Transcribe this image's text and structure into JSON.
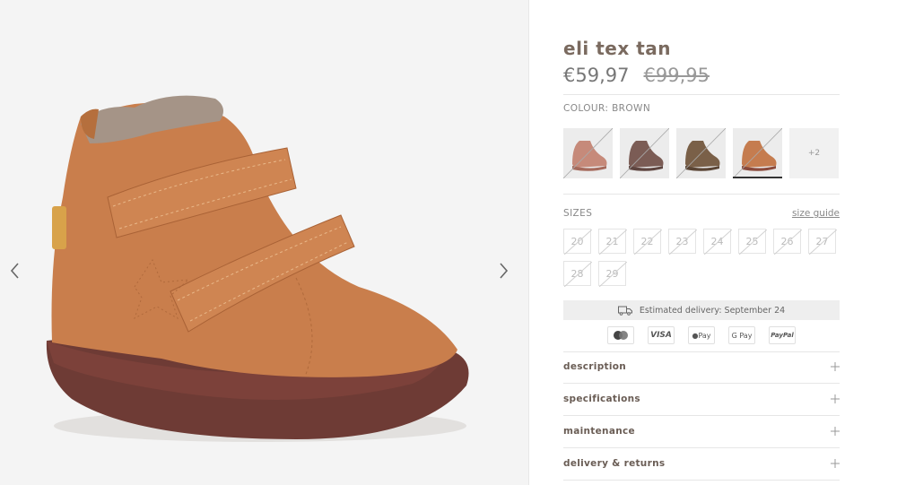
{
  "product": {
    "title": "eli tex tan",
    "price_current": "€59,97",
    "price_original": "€99,95",
    "colour_label": "COLOUR: BROWN"
  },
  "gallery": {
    "prev_icon": "chevron-left-icon",
    "next_icon": "chevron-right-icon"
  },
  "colours": {
    "swatches": [
      {
        "name": "pink",
        "color": "#c68a7a",
        "sole": "#a56a5c"
      },
      {
        "name": "mauve-brown",
        "color": "#7b5c55",
        "sole": "#5e4540"
      },
      {
        "name": "dark-brown",
        "color": "#7a6048",
        "sole": "#5a4535"
      },
      {
        "name": "tan",
        "color": "#c57c4f",
        "sole": "#8a4a3c"
      }
    ],
    "more_label": "+2"
  },
  "sizes": {
    "label": "SIZES",
    "guide_label": "size guide",
    "options": [
      "20",
      "21",
      "22",
      "23",
      "24",
      "25",
      "26",
      "27",
      "28",
      "29"
    ]
  },
  "delivery": {
    "text": "Estimated delivery: September 24",
    "icon": "truck-icon"
  },
  "payments": [
    "mastercard",
    "VISA",
    "Pay",
    "G Pay",
    "PayPal"
  ],
  "accordion": [
    {
      "label": "description"
    },
    {
      "label": "specifications"
    },
    {
      "label": "maintenance"
    },
    {
      "label": "delivery & returns"
    }
  ],
  "colors": {
    "title": "#7a6a5f",
    "text": "#555555",
    "divider": "#e6e6e6",
    "boot_leather": "#c97e4c",
    "boot_sole": "#6e3b35"
  }
}
